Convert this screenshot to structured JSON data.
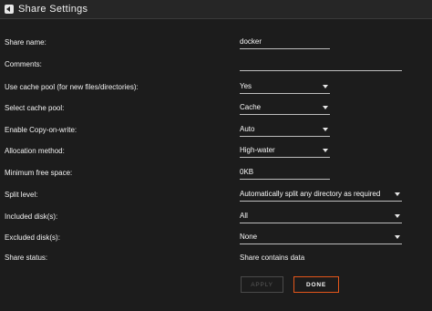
{
  "window": {
    "title": "Share Settings",
    "title_icon": "back-arrow-icon"
  },
  "settings": [
    {
      "key": "share_name",
      "label": "Share name:",
      "value": "docker",
      "type": "text"
    },
    {
      "key": "comments",
      "label": "Comments:",
      "value": "",
      "type": "text"
    },
    {
      "key": "use_cache_pool",
      "label": "Use cache pool (for new files/directories):",
      "value": "Yes",
      "type": "select"
    },
    {
      "key": "select_cache_pool",
      "label": "Select cache pool:",
      "value": "Cache",
      "type": "select"
    },
    {
      "key": "copy_on_write",
      "label": "Enable Copy-on-write:",
      "value": "Auto",
      "type": "select"
    },
    {
      "key": "allocation_method",
      "label": "Allocation method:",
      "value": "High-water",
      "type": "select"
    },
    {
      "key": "min_free_space",
      "label": "Minimum free space:",
      "value": "0KB",
      "type": "text"
    },
    {
      "key": "split_level",
      "label": "Split level:",
      "value": "Automatically split any directory as required",
      "type": "select"
    },
    {
      "key": "included_disks",
      "label": "Included disk(s):",
      "value": "All",
      "type": "select"
    },
    {
      "key": "excluded_disks",
      "label": "Excluded disk(s):",
      "value": "None",
      "type": "select"
    },
    {
      "key": "share_status",
      "label": "Share status:",
      "value": "Share contains data",
      "type": "static"
    }
  ],
  "buttons": {
    "apply": "APPLY",
    "done": "DONE"
  },
  "colors": {
    "background": "#1c1c1c",
    "accent": "#e5561a",
    "disabled_text": "#5a5a5a"
  }
}
